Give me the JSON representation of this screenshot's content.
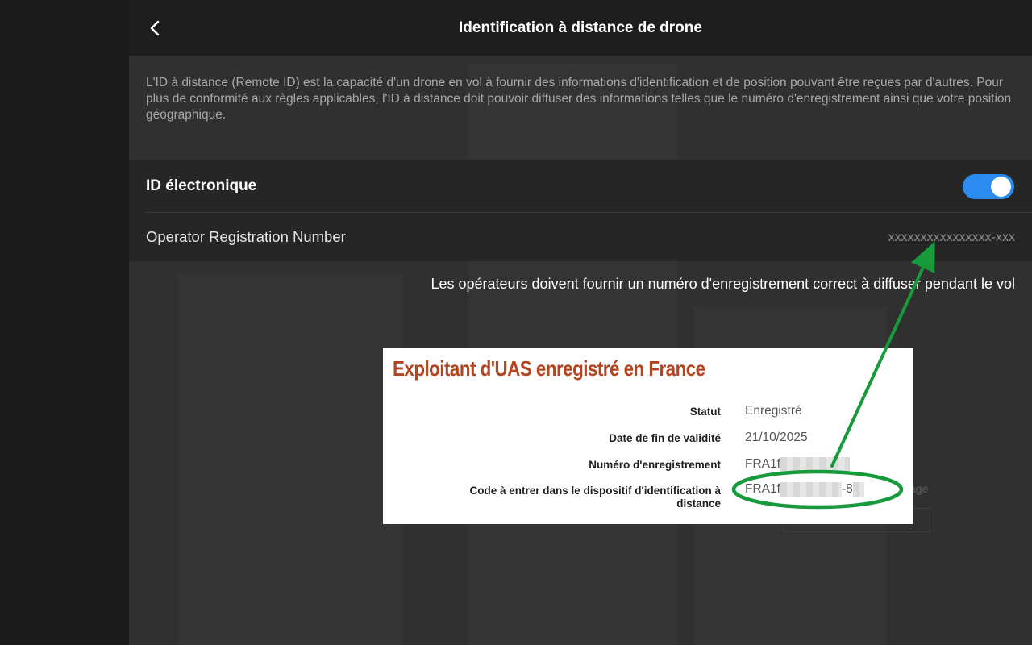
{
  "header": {
    "title": "Identification à distance de drone"
  },
  "description": "L'ID à distance (Remote ID) est la capacité d'un drone en vol à fournir des informations d'identification et de position pouvant être reçues par d'autres. Pour plus de conformité aux règles applicables, l'ID à distance doit pouvoir diffuser des informations telles que le numéro d'enregistrement ainsi que votre position géographique.",
  "settings": {
    "electronic_id": {
      "label": "ID électronique",
      "enabled": true
    },
    "operator_registration": {
      "label": "Operator Registration Number",
      "value": "xxxxxxxxxxxxxxxx-xxx"
    }
  },
  "note": "Les opérateurs doivent fournir un numéro d'enregistrement correct à diffuser pendant le vol",
  "background_hint": "age",
  "card": {
    "title": "Exploitant d'UAS enregistré en France",
    "rows": [
      {
        "label": "Statut",
        "value": "Enregistré"
      },
      {
        "label": "Date de fin de validité",
        "value": "21/10/2025"
      },
      {
        "label": "Numéro d'enregistrement",
        "value_prefix": "FRA1f"
      },
      {
        "label": "Code à entrer dans le dispositif d'identification à distance",
        "value_prefix": "FRA1f",
        "value_mid": "-8"
      }
    ]
  },
  "colors": {
    "toggle_on": "#2a8cf0",
    "card_title": "#b5441e",
    "annotation": "#169a3c"
  },
  "icons": {
    "back": "chevron-left-icon"
  }
}
